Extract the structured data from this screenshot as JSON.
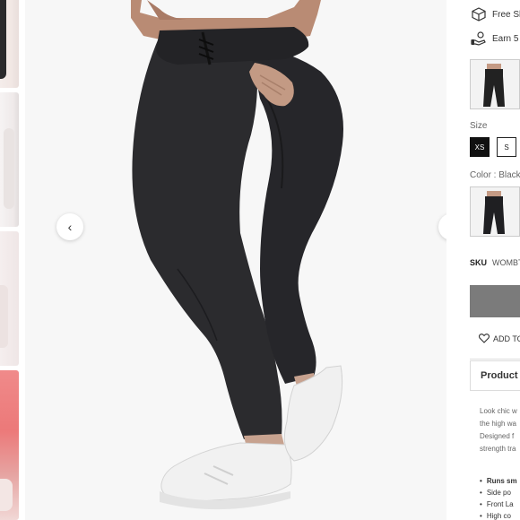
{
  "perks": {
    "shipping_text": "Free Sh",
    "shipping_icon": "box-icon",
    "rewards_text": "Earn 5",
    "rewards_icon": "hand-coin-icon"
  },
  "size": {
    "label": "Size",
    "options": [
      "XS",
      "S"
    ],
    "selected": "XS"
  },
  "color": {
    "label": "Color : Black"
  },
  "sku": {
    "label": "SKU",
    "value": "WOMBT"
  },
  "wishlist": {
    "label": "ADD TO",
    "icon": "heart-icon"
  },
  "tabs": {
    "product_title": "Product"
  },
  "description": {
    "lines": [
      "Look chic w",
      "the high wa",
      "Designed f",
      "strength tra"
    ]
  },
  "features": [
    "Runs sm",
    "Side po",
    "Front La",
    "High co"
  ],
  "nav": {
    "prev_icon": "chevron-left-icon",
    "next_icon": "chevron-right-icon",
    "prev_glyph": "‹",
    "next_glyph": "›"
  },
  "colors": {
    "selected_size_bg": "#111111",
    "add_to_cart_bg": "#7b7b7b",
    "legging": "#2b2b2e"
  }
}
